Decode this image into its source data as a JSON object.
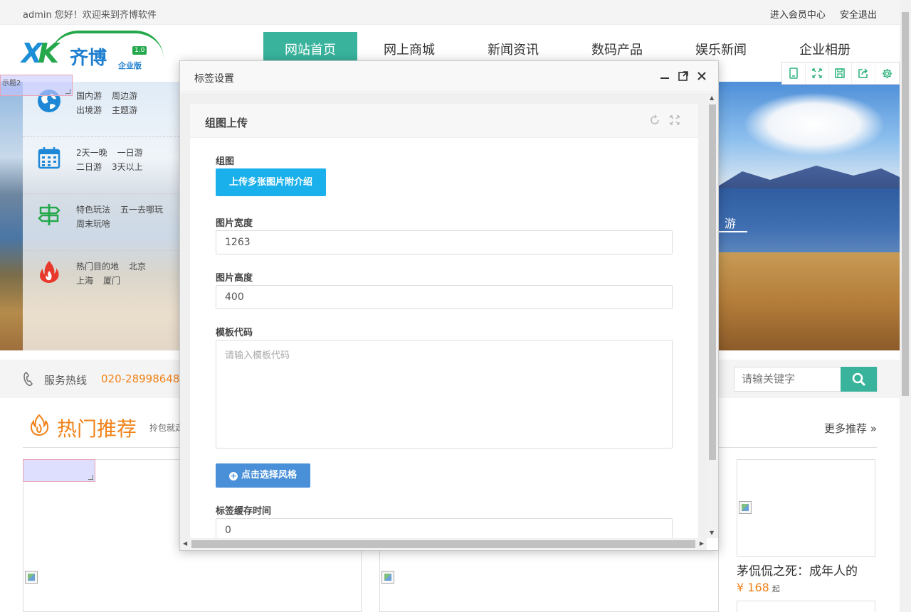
{
  "topbar": {
    "welcome": "admin 您好！欢迎来到齐博软件",
    "member_center": "进入会员中心",
    "logout": "安全退出"
  },
  "logo": {
    "brand": "齐博",
    "version": "1.0",
    "edition": "企业版"
  },
  "nav": {
    "items": [
      "网站首页",
      "网上商城",
      "新闻资讯",
      "数码产品",
      "娱乐新闻",
      "企业相册"
    ],
    "active_index": 0,
    "active_color": "#39b39c"
  },
  "categories": [
    {
      "icon": "globe-icon",
      "row1": [
        "国内游",
        "周边游"
      ],
      "row2": [
        "出境游",
        "主题游"
      ]
    },
    {
      "icon": "calendar-icon",
      "row1": [
        "2天一晚",
        "一日游"
      ],
      "row2": [
        "二日游",
        "3天以上"
      ]
    },
    {
      "icon": "signpost-icon",
      "row1": [
        "特色玩法",
        "五一去哪玩"
      ],
      "row2": [
        "周末玩啥"
      ]
    },
    {
      "icon": "fire-icon",
      "row1": [
        "热门目的地",
        "北京"
      ],
      "row2": [
        "上海",
        "厦门"
      ]
    }
  ],
  "hero": {
    "slogan": "游"
  },
  "selection_box": {
    "text": "示题2"
  },
  "hotline": {
    "label": "服务热线",
    "number": "020-28998648"
  },
  "search": {
    "placeholder": "请输关键字"
  },
  "hot": {
    "title": "热门推荐",
    "subtitle": "拎包就走",
    "more": "更多推荐 »"
  },
  "product": {
    "title": "茅侃侃之死：成年人的",
    "price": "¥ 168",
    "price_suffix": "起"
  },
  "modal": {
    "title": "标签设置",
    "panel_title": "组图上传",
    "fields": {
      "gallery_label": "组图",
      "upload_button": "上传多张图片附介绍",
      "width_label": "图片宽度",
      "width_value": "1263",
      "height_label": "图片高度",
      "height_value": "400",
      "template_label": "模板代码",
      "template_placeholder": "请输入模板代码",
      "style_button": "点击选择风格",
      "cache_label": "标签缓存时间",
      "cache_value": "0"
    }
  },
  "colors": {
    "accent": "#39b39c",
    "orange": "#f08219",
    "upload_blue": "#1ab0ec",
    "style_blue": "#4a90d9"
  }
}
